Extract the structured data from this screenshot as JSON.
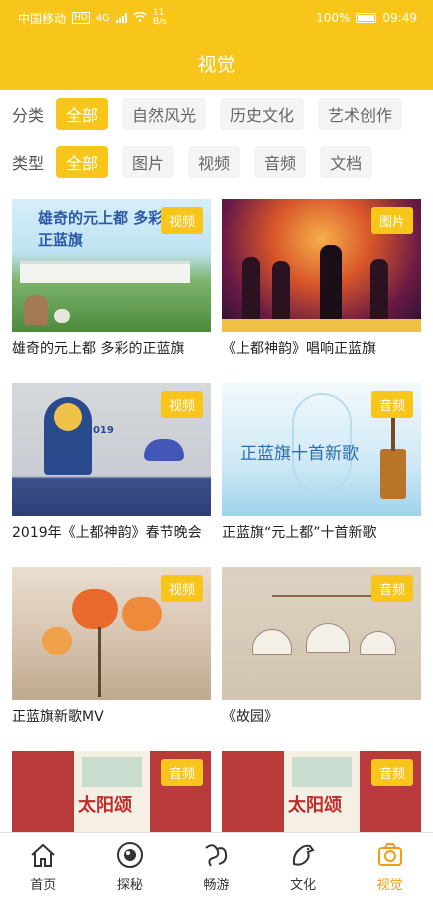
{
  "status": {
    "carrier": "中国移动",
    "hd": "HD",
    "net": "4G",
    "speed": "11 B/s",
    "battery": "100%",
    "time": "09:49"
  },
  "header": {
    "title": "视觉"
  },
  "filters": {
    "category": {
      "label": "分类",
      "options": [
        "全部",
        "自然风光",
        "历史文化",
        "艺术创作"
      ],
      "selected": "全部"
    },
    "type": {
      "label": "类型",
      "options": [
        "全部",
        "图片",
        "视频",
        "音频",
        "文档"
      ],
      "selected": "全部"
    }
  },
  "cards": [
    {
      "title": "雄奇的元上都  多彩的正蓝旗",
      "badge": "视频",
      "thumb_text": "雄奇的元上都  多彩的正蓝旗"
    },
    {
      "title": "《上都神韵》唱响正蓝旗",
      "badge": "图片",
      "thumb_text": ""
    },
    {
      "title": "2019年《上都神韵》春节晚会",
      "badge": "视频",
      "thumb_text": "2019"
    },
    {
      "title": "正蓝旗“元上都”十首新歌",
      "badge": "音频",
      "thumb_text": "正蓝旗十首新歌"
    },
    {
      "title": "正蓝旗新歌MV",
      "badge": "视频",
      "thumb_text": ""
    },
    {
      "title": "《故园》",
      "badge": "音频",
      "thumb_text": ""
    },
    {
      "title": "",
      "badge": "音频",
      "thumb_text": "太阳颂"
    },
    {
      "title": "",
      "badge": "音频",
      "thumb_text": "太阳颂"
    }
  ],
  "tabs": [
    {
      "label": "首页",
      "icon": "home-icon",
      "active": false
    },
    {
      "label": "探秘",
      "icon": "eye-icon",
      "active": false
    },
    {
      "label": "畅游",
      "icon": "dragon-icon",
      "active": false
    },
    {
      "label": "文化",
      "icon": "horse-icon",
      "active": false
    },
    {
      "label": "视觉",
      "icon": "camera-icon",
      "active": true
    }
  ],
  "colors": {
    "accent": "#f8c51a",
    "active_tab": "#f39c12"
  }
}
